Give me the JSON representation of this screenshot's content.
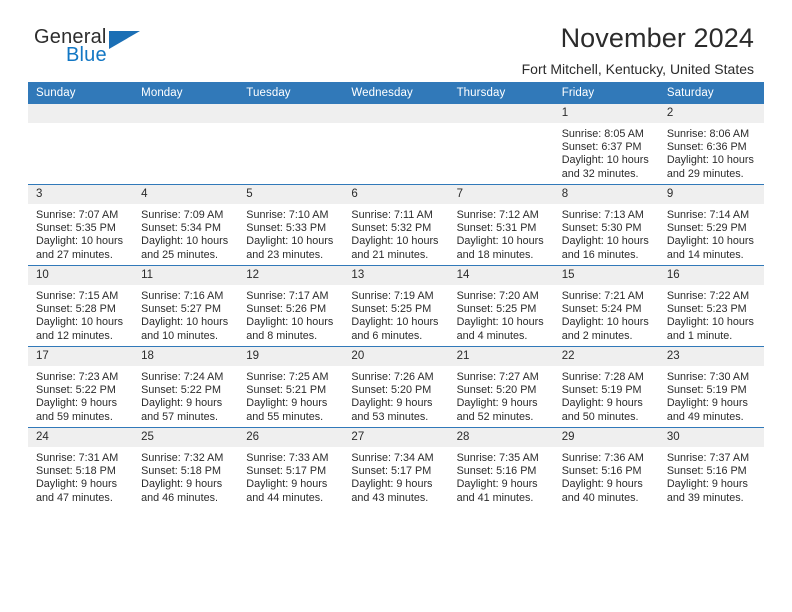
{
  "logo": {
    "word_one": "General",
    "word_two": "Blue",
    "triangle_color": "#1b6fb5",
    "word_two_color": "#1277c4"
  },
  "header": {
    "title": "November 2024",
    "subtitle": "Fort Mitchell, Kentucky, United States"
  },
  "theme": {
    "header_blue": "#3179b9",
    "daynum_gray": "#efefef",
    "text": "#2b2b2b"
  },
  "calendar": {
    "weekday_headers": [
      "Sunday",
      "Monday",
      "Tuesday",
      "Wednesday",
      "Thursday",
      "Friday",
      "Saturday"
    ],
    "labels": {
      "sunrise": "Sunrise:",
      "sunset": "Sunset:",
      "daylight": "Daylight:"
    },
    "weeks": [
      [
        {
          "day": "",
          "blank": true,
          "sunrise": "",
          "sunset": "",
          "daylight": ""
        },
        {
          "day": "",
          "blank": true,
          "sunrise": "",
          "sunset": "",
          "daylight": ""
        },
        {
          "day": "",
          "blank": true,
          "sunrise": "",
          "sunset": "",
          "daylight": ""
        },
        {
          "day": "",
          "blank": true,
          "sunrise": "",
          "sunset": "",
          "daylight": ""
        },
        {
          "day": "",
          "blank": true,
          "sunrise": "",
          "sunset": "",
          "daylight": ""
        },
        {
          "day": "1",
          "blank": false,
          "sunrise": "Sunrise: 8:05 AM",
          "sunset": "Sunset: 6:37 PM",
          "daylight": "Daylight: 10 hours and 32 minutes."
        },
        {
          "day": "2",
          "blank": false,
          "sunrise": "Sunrise: 8:06 AM",
          "sunset": "Sunset: 6:36 PM",
          "daylight": "Daylight: 10 hours and 29 minutes."
        }
      ],
      [
        {
          "day": "3",
          "blank": false,
          "sunrise": "Sunrise: 7:07 AM",
          "sunset": "Sunset: 5:35 PM",
          "daylight": "Daylight: 10 hours and 27 minutes."
        },
        {
          "day": "4",
          "blank": false,
          "sunrise": "Sunrise: 7:09 AM",
          "sunset": "Sunset: 5:34 PM",
          "daylight": "Daylight: 10 hours and 25 minutes."
        },
        {
          "day": "5",
          "blank": false,
          "sunrise": "Sunrise: 7:10 AM",
          "sunset": "Sunset: 5:33 PM",
          "daylight": "Daylight: 10 hours and 23 minutes."
        },
        {
          "day": "6",
          "blank": false,
          "sunrise": "Sunrise: 7:11 AM",
          "sunset": "Sunset: 5:32 PM",
          "daylight": "Daylight: 10 hours and 21 minutes."
        },
        {
          "day": "7",
          "blank": false,
          "sunrise": "Sunrise: 7:12 AM",
          "sunset": "Sunset: 5:31 PM",
          "daylight": "Daylight: 10 hours and 18 minutes."
        },
        {
          "day": "8",
          "blank": false,
          "sunrise": "Sunrise: 7:13 AM",
          "sunset": "Sunset: 5:30 PM",
          "daylight": "Daylight: 10 hours and 16 minutes."
        },
        {
          "day": "9",
          "blank": false,
          "sunrise": "Sunrise: 7:14 AM",
          "sunset": "Sunset: 5:29 PM",
          "daylight": "Daylight: 10 hours and 14 minutes."
        }
      ],
      [
        {
          "day": "10",
          "blank": false,
          "sunrise": "Sunrise: 7:15 AM",
          "sunset": "Sunset: 5:28 PM",
          "daylight": "Daylight: 10 hours and 12 minutes."
        },
        {
          "day": "11",
          "blank": false,
          "sunrise": "Sunrise: 7:16 AM",
          "sunset": "Sunset: 5:27 PM",
          "daylight": "Daylight: 10 hours and 10 minutes."
        },
        {
          "day": "12",
          "blank": false,
          "sunrise": "Sunrise: 7:17 AM",
          "sunset": "Sunset: 5:26 PM",
          "daylight": "Daylight: 10 hours and 8 minutes."
        },
        {
          "day": "13",
          "blank": false,
          "sunrise": "Sunrise: 7:19 AM",
          "sunset": "Sunset: 5:25 PM",
          "daylight": "Daylight: 10 hours and 6 minutes."
        },
        {
          "day": "14",
          "blank": false,
          "sunrise": "Sunrise: 7:20 AM",
          "sunset": "Sunset: 5:25 PM",
          "daylight": "Daylight: 10 hours and 4 minutes."
        },
        {
          "day": "15",
          "blank": false,
          "sunrise": "Sunrise: 7:21 AM",
          "sunset": "Sunset: 5:24 PM",
          "daylight": "Daylight: 10 hours and 2 minutes."
        },
        {
          "day": "16",
          "blank": false,
          "sunrise": "Sunrise: 7:22 AM",
          "sunset": "Sunset: 5:23 PM",
          "daylight": "Daylight: 10 hours and 1 minute."
        }
      ],
      [
        {
          "day": "17",
          "blank": false,
          "sunrise": "Sunrise: 7:23 AM",
          "sunset": "Sunset: 5:22 PM",
          "daylight": "Daylight: 9 hours and 59 minutes."
        },
        {
          "day": "18",
          "blank": false,
          "sunrise": "Sunrise: 7:24 AM",
          "sunset": "Sunset: 5:22 PM",
          "daylight": "Daylight: 9 hours and 57 minutes."
        },
        {
          "day": "19",
          "blank": false,
          "sunrise": "Sunrise: 7:25 AM",
          "sunset": "Sunset: 5:21 PM",
          "daylight": "Daylight: 9 hours and 55 minutes."
        },
        {
          "day": "20",
          "blank": false,
          "sunrise": "Sunrise: 7:26 AM",
          "sunset": "Sunset: 5:20 PM",
          "daylight": "Daylight: 9 hours and 53 minutes."
        },
        {
          "day": "21",
          "blank": false,
          "sunrise": "Sunrise: 7:27 AM",
          "sunset": "Sunset: 5:20 PM",
          "daylight": "Daylight: 9 hours and 52 minutes."
        },
        {
          "day": "22",
          "blank": false,
          "sunrise": "Sunrise: 7:28 AM",
          "sunset": "Sunset: 5:19 PM",
          "daylight": "Daylight: 9 hours and 50 minutes."
        },
        {
          "day": "23",
          "blank": false,
          "sunrise": "Sunrise: 7:30 AM",
          "sunset": "Sunset: 5:19 PM",
          "daylight": "Daylight: 9 hours and 49 minutes."
        }
      ],
      [
        {
          "day": "24",
          "blank": false,
          "sunrise": "Sunrise: 7:31 AM",
          "sunset": "Sunset: 5:18 PM",
          "daylight": "Daylight: 9 hours and 47 minutes."
        },
        {
          "day": "25",
          "blank": false,
          "sunrise": "Sunrise: 7:32 AM",
          "sunset": "Sunset: 5:18 PM",
          "daylight": "Daylight: 9 hours and 46 minutes."
        },
        {
          "day": "26",
          "blank": false,
          "sunrise": "Sunrise: 7:33 AM",
          "sunset": "Sunset: 5:17 PM",
          "daylight": "Daylight: 9 hours and 44 minutes."
        },
        {
          "day": "27",
          "blank": false,
          "sunrise": "Sunrise: 7:34 AM",
          "sunset": "Sunset: 5:17 PM",
          "daylight": "Daylight: 9 hours and 43 minutes."
        },
        {
          "day": "28",
          "blank": false,
          "sunrise": "Sunrise: 7:35 AM",
          "sunset": "Sunset: 5:16 PM",
          "daylight": "Daylight: 9 hours and 41 minutes."
        },
        {
          "day": "29",
          "blank": false,
          "sunrise": "Sunrise: 7:36 AM",
          "sunset": "Sunset: 5:16 PM",
          "daylight": "Daylight: 9 hours and 40 minutes."
        },
        {
          "day": "30",
          "blank": false,
          "sunrise": "Sunrise: 7:37 AM",
          "sunset": "Sunset: 5:16 PM",
          "daylight": "Daylight: 9 hours and 39 minutes."
        }
      ]
    ]
  }
}
